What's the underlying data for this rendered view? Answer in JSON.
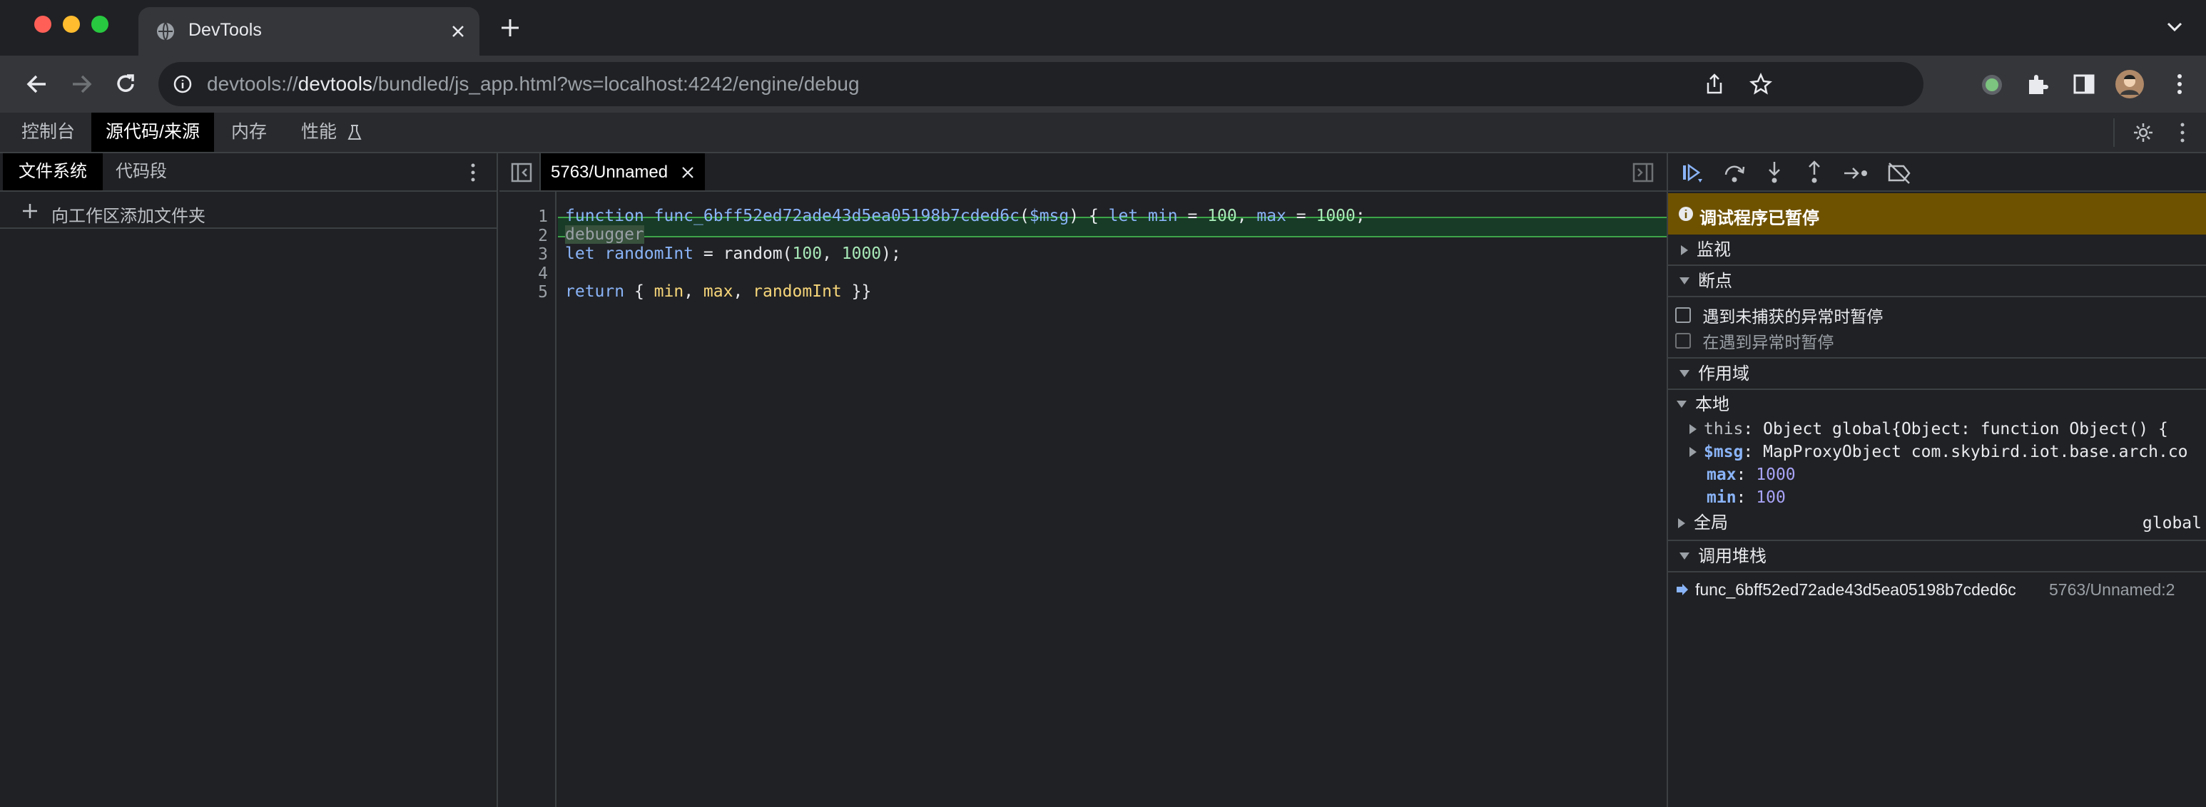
{
  "browser": {
    "tab_title": "DevTools",
    "url_prefix": "devtools://",
    "url_host": "devtools",
    "url_path": "/bundled/js_app.html?ws=localhost:4242/engine/debug"
  },
  "devtools_tabs": [
    "控制台",
    "源代码/来源",
    "内存",
    "性能"
  ],
  "active_tab": "源代码/来源",
  "navigator": {
    "tabs": [
      "文件系统",
      "代码段"
    ],
    "add_folder": "向工作区添加文件夹"
  },
  "editor": {
    "file_tab": "5763/Unnamed",
    "line_numbers": [
      "1",
      "2",
      "3",
      "4",
      "5"
    ],
    "line1": {
      "kw": "function",
      "name": "func_6bff52ed72ade43d5ea05198b7cded6c",
      "open": "(",
      "param": "$msg",
      "close": ") { ",
      "let": "let",
      "sp1": " ",
      "min": "min",
      "eq1": " = ",
      "n100": "100",
      "comma": ", ",
      "max": "max",
      "eq2": " = ",
      "n1000": "1000",
      "end": ";"
    },
    "line2": "debugger",
    "line3": {
      "let": "let",
      "var": "randomInt",
      "mid": " = random(",
      "a": "100",
      "comma": ", ",
      "b": "1000",
      "end": ");"
    },
    "line5": {
      "kw": "return",
      "open": " { ",
      "min": "min",
      "c1": ", ",
      "max": "max",
      "c2": ", ",
      "ri": "randomInt",
      "close": " }}"
    }
  },
  "debugger": {
    "paused": "调试程序已暂停",
    "watch": "监视",
    "breakpoints": "断点",
    "pause_uncaught": "遇到未捕获的异常时暂停",
    "pause_caught": "在遇到异常时暂停",
    "scope": "作用域",
    "local": "本地",
    "this_key": "this",
    "this_val": "Object global{Object: function Object() {",
    "msg_key": "$msg",
    "msg_val": "MapProxyObject com.skybird.iot.base.arch.co",
    "max_key": "max",
    "max_val": "1000",
    "min_key": "min",
    "min_val": "100",
    "global": "全局",
    "global_val": "global",
    "callstack": "调用堆栈",
    "frame_fn": "func_6bff52ed72ade43d5ea05198b7cded6c",
    "frame_loc": "5763/Unnamed:2"
  },
  "colors": {
    "paused_bg": "#6f5200",
    "exec_line": "#173b26",
    "keyword": "#8ab4f8",
    "number": "#a8e9b8",
    "defn": "#f7d67a"
  }
}
